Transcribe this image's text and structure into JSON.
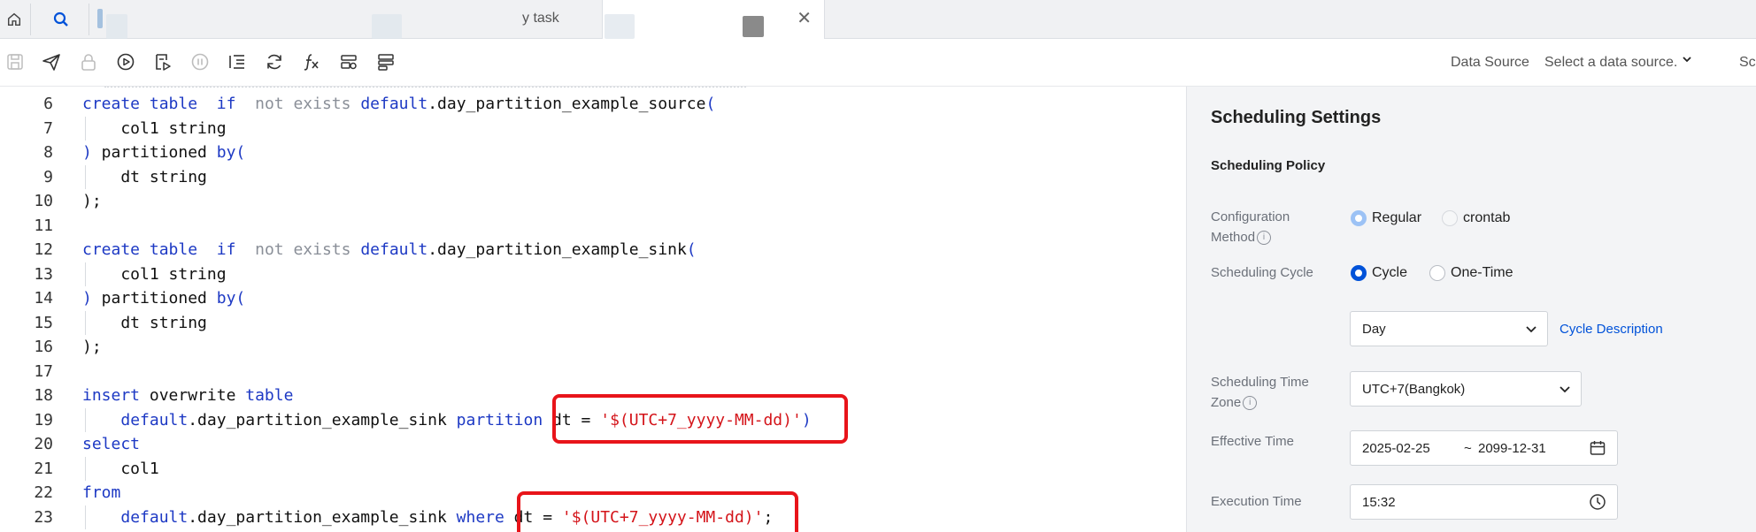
{
  "tabs": {
    "partial_title": "y task"
  },
  "toolbar": {
    "data_source_label": "Data Source",
    "data_source_placeholder": "Select a data source.",
    "truncated_label": "Sc",
    "icons": [
      "save-icon",
      "publish-icon",
      "lock-icon",
      "run-icon",
      "run-selected-icon",
      "stop-icon",
      "format-icon",
      "refresh-icon",
      "function-icon",
      "variables-icon",
      "templates-icon"
    ]
  },
  "editor": {
    "lines": [
      {
        "n": "6",
        "parts": [
          [
            "kw",
            "create table"
          ],
          [
            "",
            "  "
          ],
          [
            "kw",
            "if"
          ],
          [
            "",
            "  "
          ],
          [
            "kg",
            "not exists"
          ],
          [
            "",
            " "
          ],
          [
            "kw",
            "default"
          ],
          [
            "",
            ".day_partition_example_source"
          ],
          [
            "kw",
            "("
          ]
        ],
        "indent": false
      },
      {
        "n": "7",
        "parts": [
          [
            "",
            "    col1 string"
          ]
        ],
        "indent": true
      },
      {
        "n": "8",
        "parts": [
          [
            "kw",
            ")"
          ],
          [
            "",
            " partitioned "
          ],
          [
            "kw",
            "by("
          ]
        ],
        "indent": false
      },
      {
        "n": "9",
        "parts": [
          [
            "",
            "    dt string"
          ]
        ],
        "indent": true
      },
      {
        "n": "10",
        "parts": [
          [
            "",
            ");"
          ]
        ],
        "indent": false
      },
      {
        "n": "11",
        "parts": [],
        "indent": false
      },
      {
        "n": "12",
        "parts": [
          [
            "kw",
            "create table"
          ],
          [
            "",
            "  "
          ],
          [
            "kw",
            "if"
          ],
          [
            "",
            "  "
          ],
          [
            "kg",
            "not exists"
          ],
          [
            "",
            " "
          ],
          [
            "kw",
            "default"
          ],
          [
            "",
            ".day_partition_example_sink"
          ],
          [
            "kw",
            "("
          ]
        ],
        "indent": false
      },
      {
        "n": "13",
        "parts": [
          [
            "",
            "    col1 string"
          ]
        ],
        "indent": true
      },
      {
        "n": "14",
        "parts": [
          [
            "kw",
            ")"
          ],
          [
            "",
            " partitioned "
          ],
          [
            "kw",
            "by("
          ]
        ],
        "indent": false
      },
      {
        "n": "15",
        "parts": [
          [
            "",
            "    dt string"
          ]
        ],
        "indent": true
      },
      {
        "n": "16",
        "parts": [
          [
            "",
            ");"
          ]
        ],
        "indent": false
      },
      {
        "n": "17",
        "parts": [],
        "indent": false
      },
      {
        "n": "18",
        "parts": [
          [
            "kw",
            "insert"
          ],
          [
            "",
            " overwrite "
          ],
          [
            "kw",
            "table"
          ]
        ],
        "indent": false
      },
      {
        "n": "19",
        "parts": [
          [
            "",
            "    "
          ],
          [
            "kw",
            "default"
          ],
          [
            "",
            ".day_partition_example_sink "
          ],
          [
            "kw",
            "partition"
          ],
          [
            "",
            " dt = "
          ],
          [
            "str",
            "'$(UTC+7_yyyy-MM-dd)'"
          ],
          [
            "kw",
            ")"
          ]
        ],
        "indent": true
      },
      {
        "n": "20",
        "parts": [
          [
            "kw",
            "select"
          ]
        ],
        "indent": false
      },
      {
        "n": "21",
        "parts": [
          [
            "",
            "    col1"
          ]
        ],
        "indent": true
      },
      {
        "n": "22",
        "parts": [
          [
            "kw",
            "from"
          ]
        ],
        "indent": false
      },
      {
        "n": "23",
        "parts": [
          [
            "",
            "    "
          ],
          [
            "kw",
            "default"
          ],
          [
            "",
            ".day_partition_example_sink "
          ],
          [
            "kw",
            "where"
          ],
          [
            "",
            " dt = "
          ],
          [
            "str",
            "'$(UTC+7_yyyy-MM-dd)'"
          ],
          [
            "",
            ";"
          ]
        ],
        "indent": true
      }
    ]
  },
  "settings": {
    "title": "Scheduling Settings",
    "policy_title": "Scheduling Policy",
    "config_method": {
      "label_line1": "Configuration",
      "label_line2": "Method",
      "options": [
        "Regular",
        "crontab"
      ],
      "selected": "Regular"
    },
    "cycle": {
      "label": "Scheduling Cycle",
      "options": [
        "Cycle",
        "One-Time"
      ],
      "selected": "Cycle",
      "unit": "Day",
      "description_link": "Cycle Description"
    },
    "timezone": {
      "label_line1": "Scheduling Time",
      "label_line2": "Zone",
      "value": "UTC+7(Bangkok)"
    },
    "effective_time": {
      "label": "Effective Time",
      "start": "2025-02-25",
      "separator": "~",
      "end": "2099-12-31"
    },
    "execution_time": {
      "label": "Execution Time",
      "value": "15:32"
    }
  },
  "colors": {
    "accent": "#0052d9",
    "keyword": "#1d39c4",
    "string": "#d4141a",
    "highlight_box": "#e8141a"
  }
}
